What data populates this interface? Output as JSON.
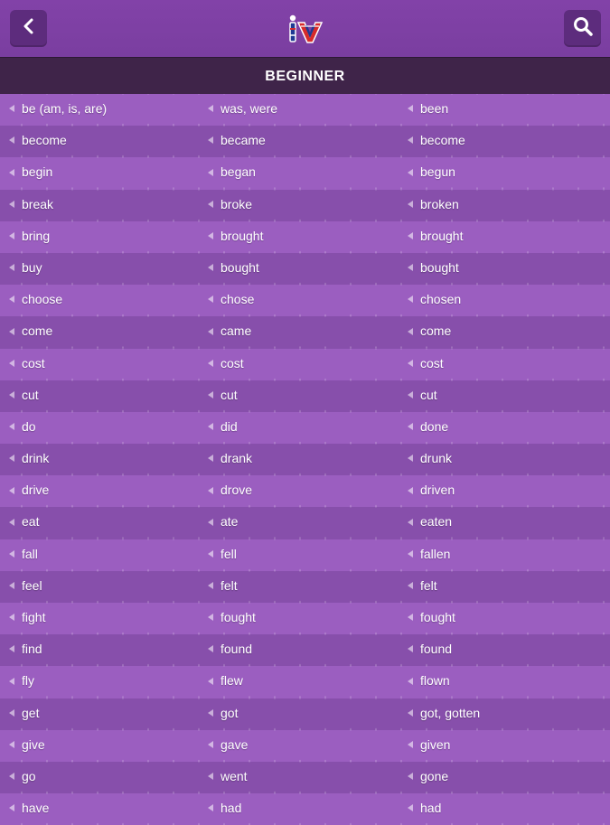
{
  "header": {
    "back_icon": "chevron-left-icon",
    "logo_text": "iv",
    "search_icon": "search-icon"
  },
  "section": {
    "title": "BEGINNER"
  },
  "colors": {
    "topbar": "#7f40a5",
    "button": "#5d2c7d",
    "section_bar": "#3f2449",
    "row_light": "#9b5ec0",
    "row_dark": "#874fab"
  },
  "verbs": [
    {
      "base": "be (am, is, are)",
      "past": "was, were",
      "participle": "been"
    },
    {
      "base": "become",
      "past": "became",
      "participle": "become"
    },
    {
      "base": "begin",
      "past": "began",
      "participle": "begun"
    },
    {
      "base": "break",
      "past": "broke",
      "participle": "broken"
    },
    {
      "base": "bring",
      "past": "brought",
      "participle": "brought"
    },
    {
      "base": "buy",
      "past": "bought",
      "participle": "bought"
    },
    {
      "base": "choose",
      "past": "chose",
      "participle": "chosen"
    },
    {
      "base": "come",
      "past": "came",
      "participle": "come"
    },
    {
      "base": "cost",
      "past": "cost",
      "participle": "cost"
    },
    {
      "base": "cut",
      "past": "cut",
      "participle": "cut"
    },
    {
      "base": "do",
      "past": "did",
      "participle": "done"
    },
    {
      "base": "drink",
      "past": "drank",
      "participle": "drunk"
    },
    {
      "base": "drive",
      "past": "drove",
      "participle": "driven"
    },
    {
      "base": "eat",
      "past": "ate",
      "participle": "eaten"
    },
    {
      "base": "fall",
      "past": "fell",
      "participle": "fallen"
    },
    {
      "base": "feel",
      "past": "felt",
      "participle": "felt"
    },
    {
      "base": "fight",
      "past": "fought",
      "participle": "fought"
    },
    {
      "base": "find",
      "past": "found",
      "participle": "found"
    },
    {
      "base": "fly",
      "past": "flew",
      "participle": "flown"
    },
    {
      "base": "get",
      "past": "got",
      "participle": "got, gotten"
    },
    {
      "base": "give",
      "past": "gave",
      "participle": "given"
    },
    {
      "base": "go",
      "past": "went",
      "participle": "gone"
    },
    {
      "base": "have",
      "past": "had",
      "participle": "had"
    }
  ]
}
